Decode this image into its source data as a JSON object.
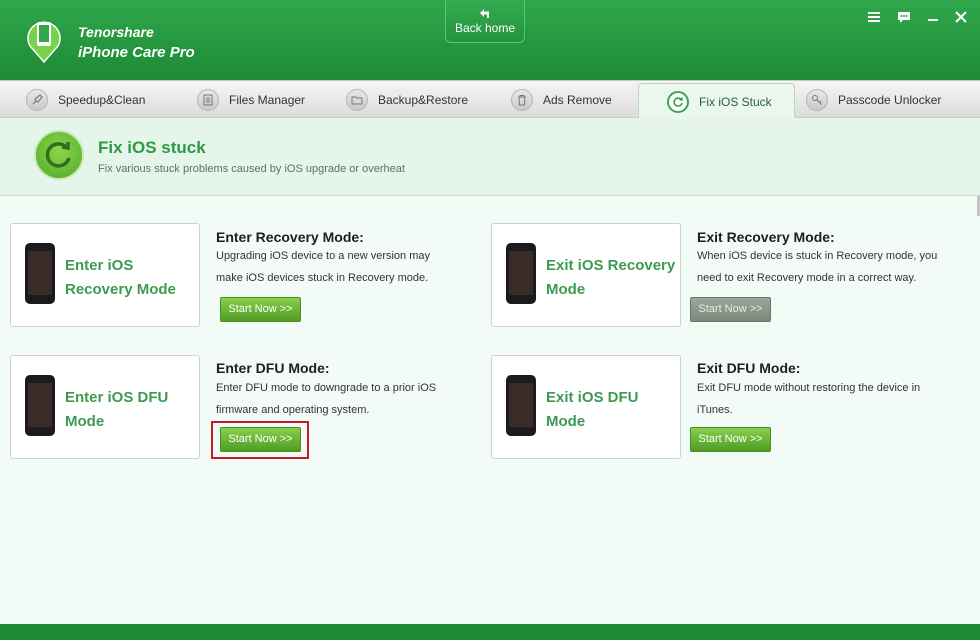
{
  "app": {
    "brand_line1": "Tenorshare",
    "brand_line2": "iPhone Care Pro"
  },
  "back_home": {
    "label": "Back home"
  },
  "tabs": [
    {
      "label": "Speedup&Clean",
      "icon": "rocket-icon"
    },
    {
      "label": "Files Manager",
      "icon": "files-icon"
    },
    {
      "label": "Backup&Restore",
      "icon": "folder-icon"
    },
    {
      "label": "Ads Remove",
      "icon": "trash-icon"
    },
    {
      "label": "Fix iOS Stuck",
      "icon": "refresh-icon",
      "active": true
    },
    {
      "label": "Passcode Unlocker",
      "icon": "key-icon"
    }
  ],
  "header": {
    "title": "Fix iOS stuck",
    "subtitle": "Fix various stuck problems caused by iOS upgrade or overheat"
  },
  "modes": [
    {
      "card_title": "Enter iOS Recovery Mode",
      "title": "Enter Recovery Mode:",
      "description": "Upgrading iOS device to a new version may make iOS devices stuck in Recovery mode.",
      "button": "Start Now >>",
      "enabled": true
    },
    {
      "card_title": "Exit iOS Recovery Mode",
      "title": "Exit Recovery Mode:",
      "description": "When iOS device is stuck in Recovery mode, you need to exit Recovery mode in a correct way.",
      "button": "Start Now >>",
      "enabled": false
    },
    {
      "card_title": "Enter iOS DFU Mode",
      "title": "Enter DFU Mode:",
      "description": "Enter DFU mode to downgrade to a prior iOS firmware and operating system.",
      "button": "Start Now >>",
      "enabled": true,
      "highlighted": true
    },
    {
      "card_title": "Exit iOS DFU Mode",
      "title": "Exit DFU Mode:",
      "description": "Exit DFU mode without restoring the device in iTunes.",
      "button": "Start Now >>",
      "enabled": true
    }
  ],
  "colors": {
    "brand_green": "#2b9d45",
    "accent_green": "#3d9a51",
    "highlight_red": "#c31d2a"
  }
}
